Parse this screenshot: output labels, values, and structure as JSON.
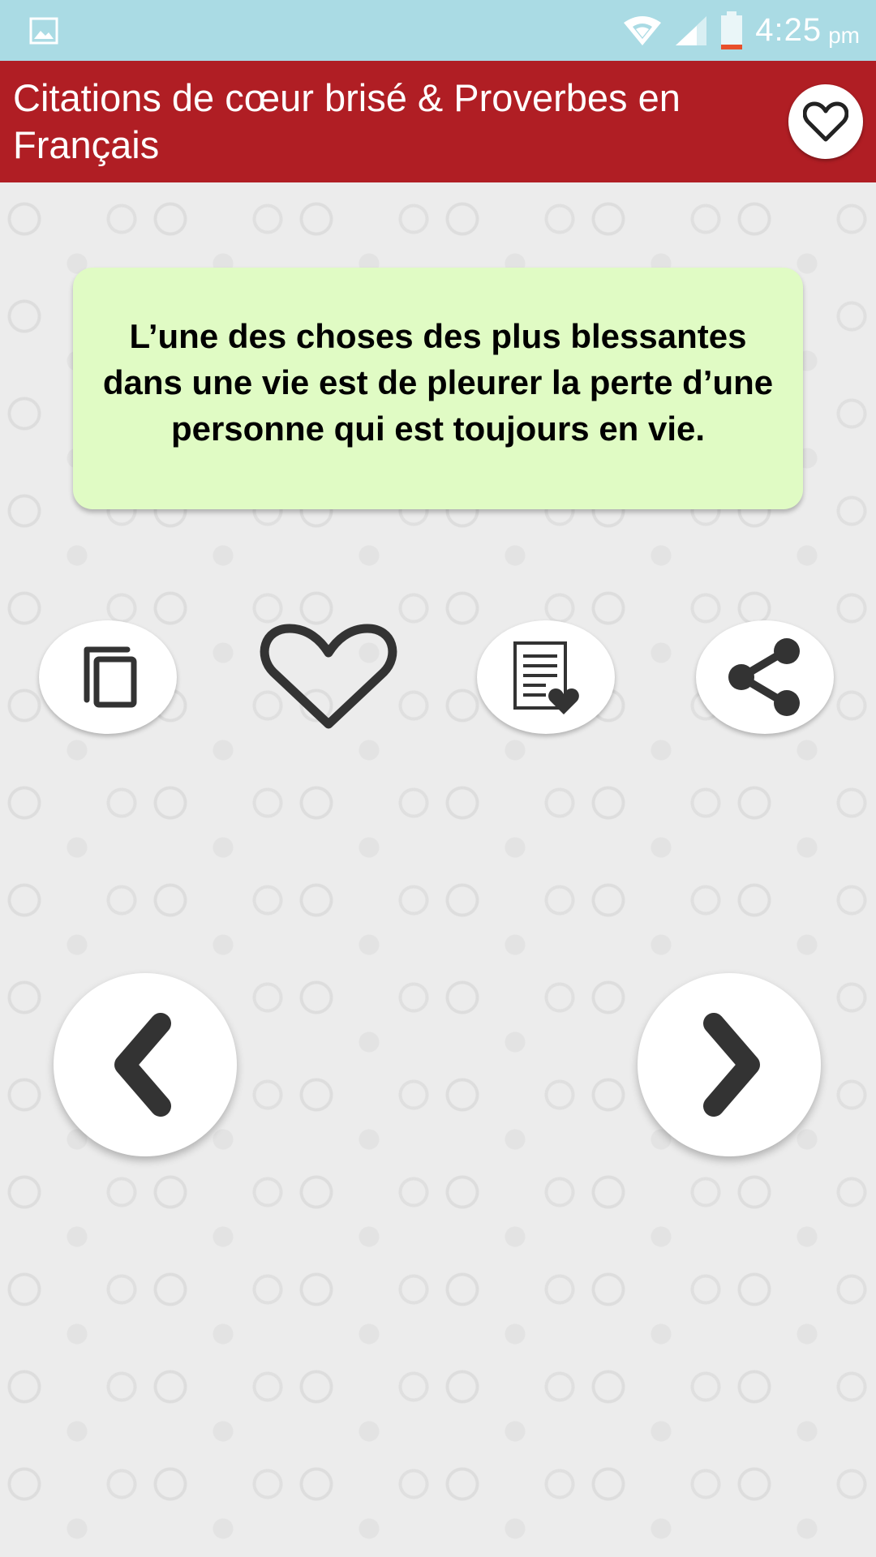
{
  "status_bar": {
    "time": "4:25",
    "ampm": "pm",
    "icons": [
      "image-icon",
      "wifi-icon",
      "signal-icon",
      "battery-icon"
    ]
  },
  "app_bar": {
    "title": "Citations de cœur brisé & Proverbes en Français",
    "favorites_icon": "heart-outline-icon"
  },
  "quote": {
    "text": "L’une des choses des plus blessantes dans une vie est de pleurer la perte d’une personne qui est toujours en vie."
  },
  "actions": [
    {
      "name": "copy",
      "icon": "copy-icon"
    },
    {
      "name": "favorite",
      "icon": "heart-outline-icon"
    },
    {
      "name": "saved-list",
      "icon": "document-heart-icon"
    },
    {
      "name": "share",
      "icon": "share-icon"
    }
  ],
  "navigation": {
    "previous_icon": "chevron-left-icon",
    "next_icon": "chevron-right-icon"
  },
  "colors": {
    "status_bar": "#aadbe4",
    "app_bar": "#b01e24",
    "quote_card": "#e0fbc4",
    "icon_dark": "#333333",
    "battery_low": "#e8502b"
  }
}
